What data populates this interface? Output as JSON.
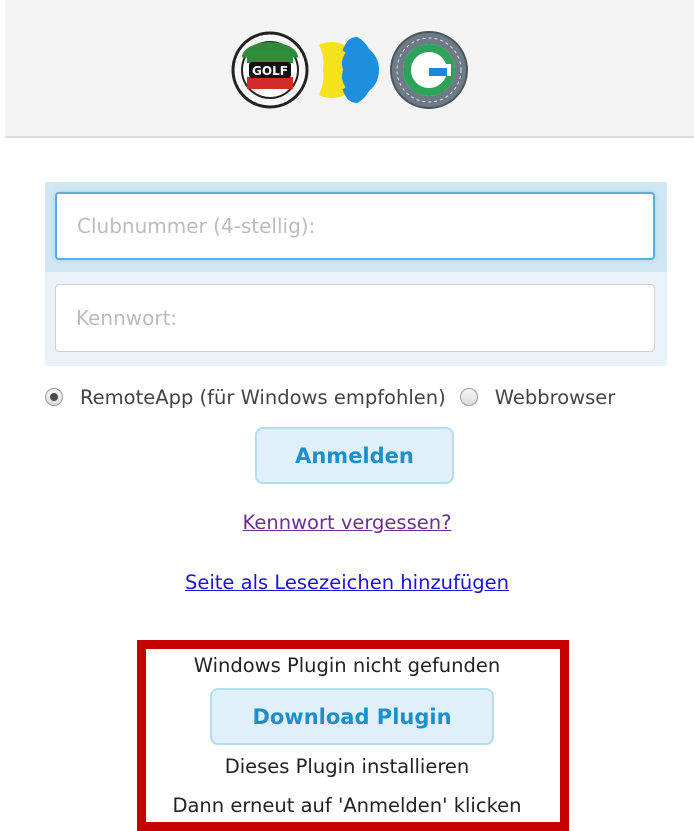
{
  "header": {
    "logos": [
      {
        "icon": "golf-verband-seal-icon",
        "text": "GOLF"
      },
      {
        "icon": "blue-yellow-emblem-icon"
      },
      {
        "icon": "deutscher-golf-verband-g-icon",
        "text": "G"
      }
    ]
  },
  "login": {
    "club_placeholder": "Clubnummer (4-stellig):",
    "club_value": "",
    "password_placeholder": "Kennwort:",
    "password_value": "",
    "mode_options": [
      {
        "label": "RemoteApp (für Windows empfohlen)",
        "selected": true
      },
      {
        "label": "Webbrowser",
        "selected": false
      }
    ],
    "submit_label": "Anmelden",
    "forgot_label": "Kennwort vergessen?",
    "bookmark_label": "Seite als Lesezeichen hinzufügen"
  },
  "plugin": {
    "not_found_text": "Windows Plugin nicht gefunden",
    "download_label": "Download Plugin",
    "install_text": "Dieses Plugin installieren",
    "retry_text": "Dann erneut auf 'Anmelden' klicken"
  },
  "colors": {
    "accent": "#1e8fc8",
    "button_bg": "#dff0fa",
    "highlight_border": "#c40000",
    "header_bg": "#f3f3f3"
  }
}
